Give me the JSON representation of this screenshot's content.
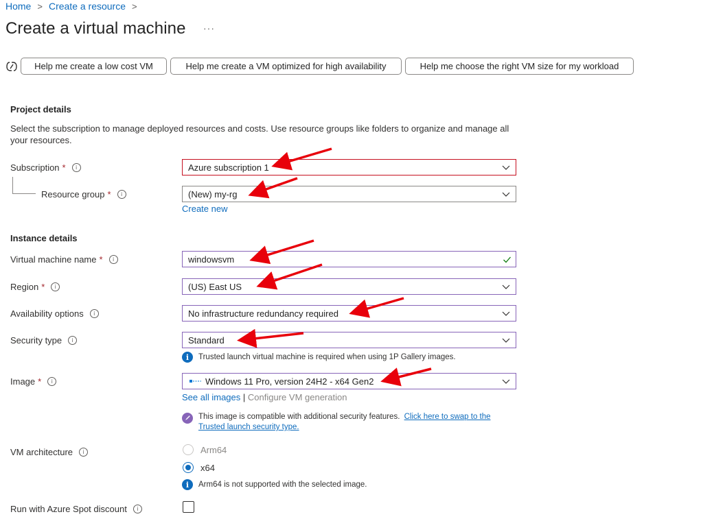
{
  "breadcrumb": {
    "home": "Home",
    "create_resource": "Create a resource",
    "sep": ">"
  },
  "page": {
    "title": "Create a virtual machine",
    "more": "···"
  },
  "copilot_prompts": [
    "Help me create a low cost VM",
    "Help me create a VM optimized for high availability",
    "Help me choose the right VM size for my workload"
  ],
  "project": {
    "heading": "Project details",
    "description": "Select the subscription to manage deployed resources and costs. Use resource groups like folders to organize and manage all your resources.",
    "subscription_label": "Subscription",
    "subscription_value": "Azure subscription 1",
    "resource_group_label": "Resource group",
    "resource_group_value": "(New) my-rg",
    "create_new": "Create new"
  },
  "instance": {
    "heading": "Instance details",
    "vm_name_label": "Virtual machine name",
    "vm_name_value": "windowsvm",
    "region_label": "Region",
    "region_value": "(US) East US",
    "availability_label": "Availability options",
    "availability_value": "No infrastructure redundancy required",
    "security_label": "Security type",
    "security_value": "Standard",
    "security_note": "Trusted launch virtual machine is required when using 1P Gallery images.",
    "image_label": "Image",
    "image_value": "Windows 11 Pro, version 24H2 - x64 Gen2",
    "see_all_images": "See all images",
    "link_sep": "|",
    "configure_generation": "Configure VM generation",
    "compat_note": "This image is compatible with additional security features.",
    "compat_link": "Click here to swap to the Trusted launch security type.",
    "arch_label": "VM architecture",
    "arch_options": [
      "Arm64",
      "x64"
    ],
    "arch_selected": "x64",
    "arch_note": "Arm64 is not supported with the selected image.",
    "spot_label": "Run with Azure Spot discount"
  },
  "required_marker": "*",
  "info_glyph": "i",
  "colors": {
    "accent": "#0f6cbd",
    "error_border": "#c50f1f",
    "valid_border": "#8764b8",
    "annotation_arrow": "#e8000b",
    "required": "#a4262c"
  }
}
